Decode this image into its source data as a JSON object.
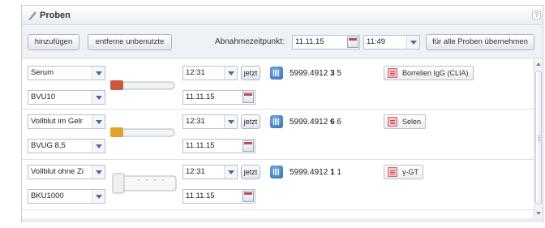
{
  "panel": {
    "title": "Proben",
    "help": "?"
  },
  "toolbar": {
    "add_label": "hinzufügen",
    "remove_unused_label": "entferne unbenutzte",
    "collection_label": "Abnahmezeitpunkt:",
    "date": "11.11.15",
    "time": "11:49",
    "apply_all_label": "für alle Proben übernehmen"
  },
  "rows": [
    {
      "material": "Serum",
      "container": "BVU10",
      "time": "12:31",
      "now_label": "jetzt",
      "date": "11.11.15",
      "barcode_prefix": "5999.4912",
      "barcode_bold": "3",
      "barcode_suffix": "5",
      "test": "Borrelien IgG (CLIA)",
      "tube_cap_color": "#c9583f"
    },
    {
      "material": "Vollblut im Gelr",
      "container": "BVUG 8,5",
      "time": "12:31",
      "now_label": "jetzt",
      "date": "11.11.15",
      "barcode_prefix": "5999.4912",
      "barcode_bold": "6",
      "barcode_suffix": "6",
      "test": "Selen",
      "tube_cap_color": "#e2a12c"
    },
    {
      "material": "Vollblut ohne Zi",
      "container": "BKU1000",
      "time": "12:31",
      "now_label": "jetzt",
      "date": "11.11.15",
      "barcode_prefix": "5999.4912",
      "barcode_bold": "1",
      "barcode_suffix": "1",
      "test": "γ-GT",
      "tube_cap_color": "#f0f0f0"
    }
  ]
}
